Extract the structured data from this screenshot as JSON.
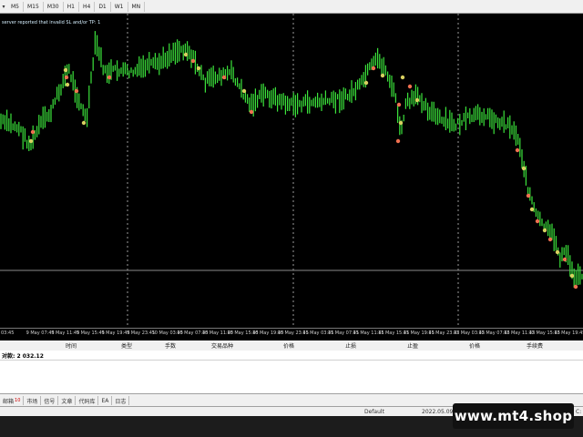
{
  "toolbar": {
    "timeframes": [
      "M5",
      "M15",
      "M30",
      "H1",
      "H4",
      "D1",
      "W1",
      "MN"
    ]
  },
  "chart": {
    "message": "server reported that invalid SL and/or TP: 1",
    "x_labels": [
      "03:45",
      "9 May 07:45",
      "9 May 11:45",
      "9 May 15:45",
      "9 May 19:45",
      "9 May 23:45",
      "10 May 03:45",
      "10 May 07:45",
      "10 May 11:45",
      "10 May 15:45",
      "10 May 19:45",
      "10 May 23:45",
      "11 May 03:45",
      "11 May 07:45",
      "11 May 11:45",
      "11 May 15:45",
      "11 May 19:45",
      "11 May 23:45",
      "12 May 03:45",
      "12 May 07:45",
      "12 May 11:45",
      "12 May 15:45",
      "12 May 19:45"
    ],
    "colors": {
      "background": "#000000",
      "candle": "#3be33b",
      "arrow_buy": "#f07050",
      "arrow_sell": "#d8d060",
      "separator": "#9a9a9a"
    }
  },
  "terminal": {
    "columns": [
      "时间",
      "类型",
      "手数",
      "交易品种",
      "价格",
      "止损",
      "止盈",
      "价格",
      "手续费"
    ],
    "balance_text": "对款: 2 032.12",
    "tabs": [
      {
        "label": "邮箱",
        "badge": "10"
      },
      {
        "label": "市场",
        "badge": ""
      },
      {
        "label": "信号",
        "badge": ""
      },
      {
        "label": "文章",
        "badge": ""
      },
      {
        "label": "代码库",
        "badge": ""
      },
      {
        "label": "EA",
        "badge": ""
      },
      {
        "label": "日志",
        "badge": ""
      }
    ]
  },
  "status": {
    "profile": "Default",
    "datetime": "2022.05.09 2",
    "right": "C:"
  },
  "watermark": "www.mt4.shop"
}
